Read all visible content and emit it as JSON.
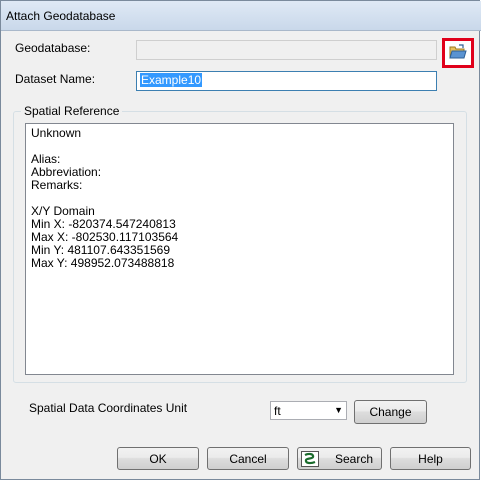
{
  "window": {
    "title": "Attach Geodatabase"
  },
  "form": {
    "geodatabase_label": "Geodatabase:",
    "geodatabase_value": "",
    "dataset_label": "Dataset Name:",
    "dataset_value": "Example10"
  },
  "spatial_reference": {
    "group_label": "Spatial Reference",
    "lines": [
      "Unknown",
      "",
      "Alias:",
      "Abbreviation:",
      "Remarks:",
      "",
      "X/Y Domain",
      "Min X: -820374.547240813",
      "Max X: -802530.117103564",
      "Min Y: 481107.643351569",
      "Max Y: 498952.073488818"
    ],
    "unit_label": "Spatial Data Coordinates Unit",
    "unit_value": "ft",
    "change_label": "Change"
  },
  "buttons": {
    "ok": "OK",
    "cancel": "Cancel",
    "search": "Search",
    "help": "Help"
  },
  "icons": {
    "browse": "folder-open-icon",
    "search": "search-icon"
  },
  "colors": {
    "highlight_border": "#e0001a",
    "selection": "#3399ff"
  }
}
